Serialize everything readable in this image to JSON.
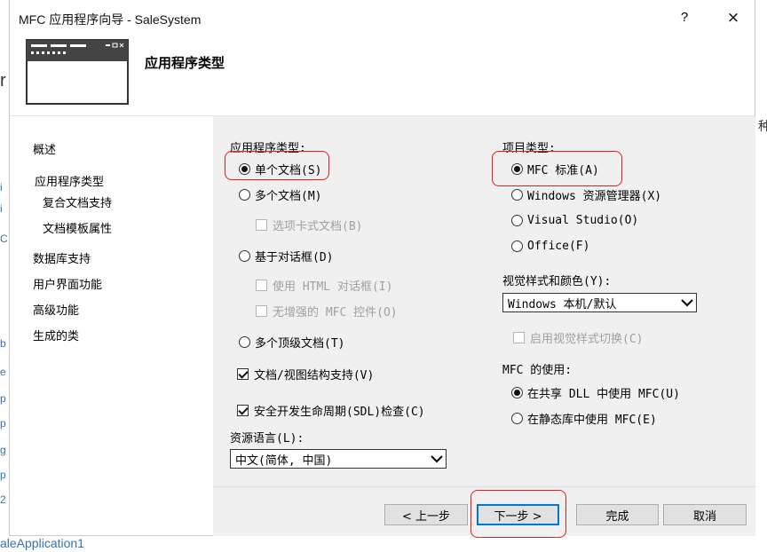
{
  "window": {
    "title": "MFC 应用程序向导 - SaleSystem",
    "help": "?",
    "close": "×"
  },
  "header": {
    "title": "应用程序类型"
  },
  "nav": [
    {
      "label": "概述",
      "indent": false
    },
    {
      "label": "应用程序类型",
      "indent": false
    },
    {
      "label": "复合文档支持",
      "indent": true
    },
    {
      "label": "文档模板属性",
      "indent": true
    },
    {
      "label": "数据库支持",
      "indent": false
    },
    {
      "label": "用户界面功能",
      "indent": false
    },
    {
      "label": "高级功能",
      "indent": false
    },
    {
      "label": "生成的类",
      "indent": false
    }
  ],
  "app_type": {
    "label": "应用程序类型:",
    "single": "单个文档(S)",
    "multi": "多个文档(M)",
    "tabbed": "选项卡式文档(B)",
    "dialog": "基于对话框(D)",
    "html_dialog": "使用 HTML 对话框(I)",
    "no_enhanced": "无增强的 MFC 控件(O)",
    "multi_top": "多个顶级文档(T)",
    "selected": "single"
  },
  "docview": {
    "label": "文档/视图结构支持(V)",
    "checked": true
  },
  "sdl": {
    "label": "安全开发生命周期(SDL)检查(C)",
    "checked": true
  },
  "resource_lang": {
    "label": "资源语言(L):",
    "value": "中文(简体, 中国)"
  },
  "project_type": {
    "label": "项目类型:",
    "mfc_std": "MFC 标准(A)",
    "explorer": "Windows 资源管理器(X)",
    "vs": "Visual Studio(O)",
    "office": "Office(F)",
    "selected": "mfc_std"
  },
  "visual_style": {
    "label": "视觉样式和颜色(Y):",
    "value": "Windows 本机/默认",
    "switch_label": "启用视觉样式切换(C)"
  },
  "mfc_use": {
    "label": "MFC 的使用:",
    "shared": "在共享 DLL 中使用 MFC(U)",
    "static": "在静态库中使用 MFC(E)",
    "selected": "shared"
  },
  "buttons": {
    "prev": "< 上一步",
    "next": "下一步 >",
    "finish": "完成",
    "cancel": "取消"
  },
  "background": {
    "left_chars": [
      "r",
      "i",
      "i",
      "C",
      "b",
      "e",
      "p",
      "p",
      "g",
      "p",
      "2"
    ],
    "right_char": "种",
    "bottom_text": "aleApplication1"
  },
  "colors": {
    "annotation": "#e01e1e",
    "accent": "#0078d7",
    "panel": "#f0f0f0"
  }
}
